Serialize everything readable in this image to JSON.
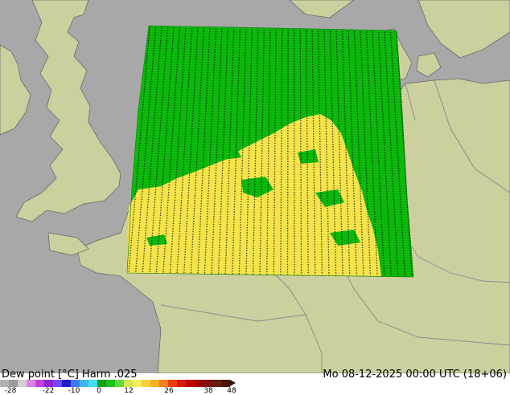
{
  "title": "Dew point [°C] Harm .025",
  "valid_time": "Mo 08-12-2025 00:00 UTC (18+06)",
  "map": {
    "colors": {
      "sea": "#a8a8a8",
      "land": "#ccd09e",
      "border": "#8a8a8a",
      "coast": "#6a6a6a",
      "domain_green": "#0cb80c",
      "domain_yellow": "#f5e34a",
      "label_ink": "#000000"
    }
  },
  "legend": {
    "ticks": [
      "-28",
      "-22",
      "-10",
      "0",
      "12",
      "26",
      "38",
      "48"
    ],
    "colors": [
      "#b4b4b4",
      "#9a9a9a",
      "#d0d0d0",
      "#e080e8",
      "#c040e0",
      "#9020d0",
      "#7048ff",
      "#2020c0",
      "#3c78f0",
      "#40b4f0",
      "#40e0f0",
      "#10a010",
      "#20c020",
      "#60d840",
      "#d8e850",
      "#f0f060",
      "#f8d040",
      "#f8b020",
      "#f08018",
      "#e84010",
      "#d81818",
      "#c00000",
      "#a00000",
      "#801010",
      "#602010",
      "#4a1808"
    ]
  }
}
